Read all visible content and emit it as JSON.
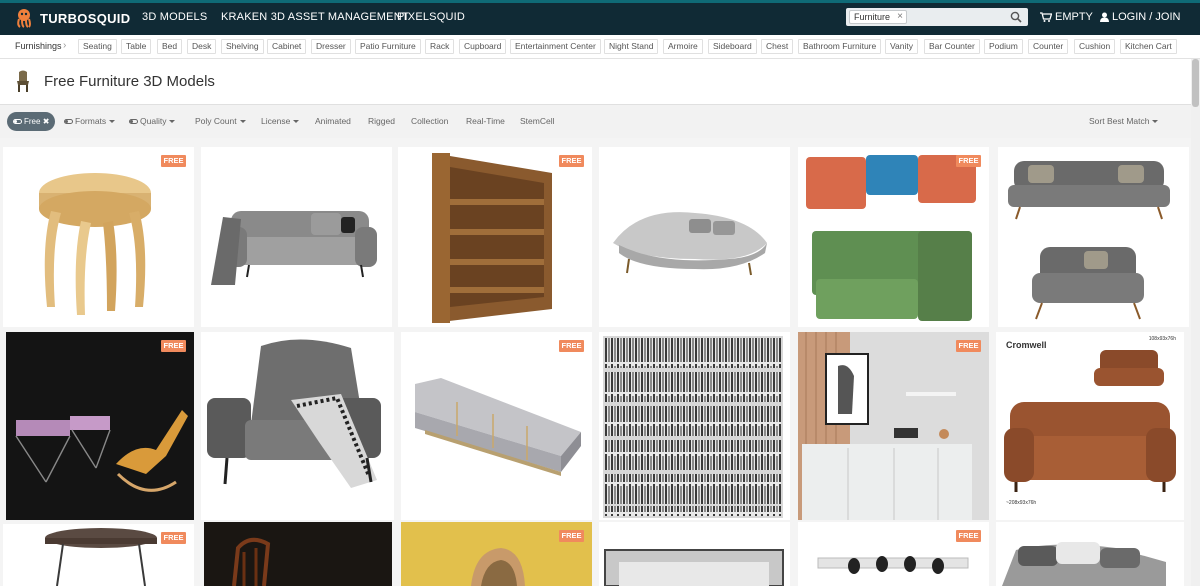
{
  "header": {
    "brand": "TURBOSQUID",
    "nav": [
      "3D MODELS",
      "KRAKEN 3D ASSET MANAGEMENT",
      "PIXELSQUID"
    ],
    "search_chip": "Furniture",
    "cart_label": "EMPTY",
    "login_label": "LOGIN / JOIN"
  },
  "categories": {
    "root": "Furnishings",
    "items": [
      "Seating",
      "Table",
      "Bed",
      "Desk",
      "Shelving",
      "Cabinet",
      "Dresser",
      "Patio Furniture",
      "Rack",
      "Cupboard",
      "Entertainment Center",
      "Night Stand",
      "Armoire",
      "Sideboard",
      "Chest",
      "Bathroom Furniture",
      "Vanity",
      "Bar Counter",
      "Podium",
      "Counter",
      "Cushion",
      "Kitchen Cart"
    ]
  },
  "page": {
    "title": "Free Furniture 3D Models"
  },
  "filters": {
    "active": "Free",
    "items": [
      "Formats",
      "Quality",
      "Poly Count",
      "License",
      "Animated",
      "Rigged",
      "Collection",
      "Real-Time",
      "StemCell"
    ],
    "sort": "Sort Best Match"
  },
  "products": {
    "badge": "FREE",
    "tiles": [
      {
        "name": "wooden-stool",
        "free": true
      },
      {
        "name": "grey-sofa-blanket",
        "free": false
      },
      {
        "name": "wooden-bookshelf",
        "free": true
      },
      {
        "name": "curved-sofa",
        "free": false
      },
      {
        "name": "sectional-sofas",
        "free": true
      },
      {
        "name": "mid-century-sofa-armchair",
        "free": false
      },
      {
        "name": "lounge-chairs-dark",
        "free": true
      },
      {
        "name": "tufted-armchair",
        "free": false
      },
      {
        "name": "sideboard-cabinet",
        "free": true
      },
      {
        "name": "bookshelf-books",
        "free": false
      },
      {
        "name": "interior-sideboard",
        "free": true
      },
      {
        "name": "chesterfield-sofa",
        "free": false
      },
      {
        "name": "bar-table",
        "free": true
      },
      {
        "name": "bentwood-chair",
        "free": false
      },
      {
        "name": "wooden-chair-yellow",
        "free": true
      },
      {
        "name": "frame-model",
        "free": false
      },
      {
        "name": "dining-set",
        "free": true
      },
      {
        "name": "bed-pillows",
        "free": false
      }
    ],
    "cromwell_label": "Cromwell",
    "dim_top": "108x93x76h",
    "dim_bottom": "~208x93x76h"
  }
}
